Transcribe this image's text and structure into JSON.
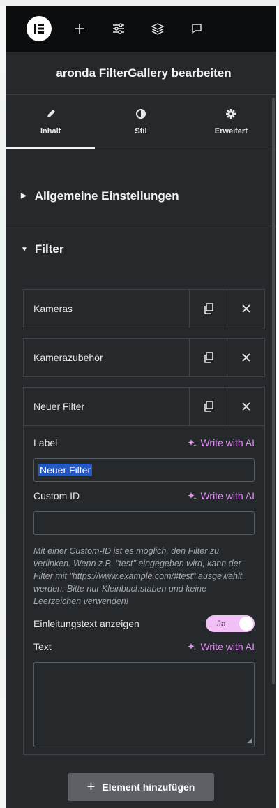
{
  "topbar": {
    "icons": [
      "elementor-logo-icon",
      "plus-icon",
      "sliders-icon",
      "layers-icon",
      "chat-icon"
    ]
  },
  "header": {
    "title": "aronda FilterGallery bearbeiten"
  },
  "tabs": [
    {
      "label": "Inhalt",
      "icon": "pencil-icon",
      "active": true
    },
    {
      "label": "Stil",
      "icon": "contrast-icon",
      "active": false
    },
    {
      "label": "Erweitert",
      "icon": "gear-icon",
      "active": false
    }
  ],
  "sections": {
    "general": {
      "label": "Allgemeine Einstellungen"
    },
    "filter": {
      "label": "Filter"
    }
  },
  "repeater": {
    "items": [
      {
        "label": "Kameras"
      },
      {
        "label": "Kamerazubehör"
      },
      {
        "label": "Neuer Filter"
      }
    ]
  },
  "editor": {
    "label_field": {
      "label": "Label",
      "value": "Neuer Filter"
    },
    "custom_id_field": {
      "label": "Custom ID",
      "value": ""
    },
    "ai_link": "Write with AI",
    "help_text": "Mit einer Custom-ID ist es möglich, den Filter zu verlinken. Wenn z.B. \"test\" eingegeben wird, kann der Filter mit \"https://www.example.com/#test\" ausgewählt werden. Bitte nur Kleinbuchstaben und keine Leerzeichen verwenden!",
    "intro_toggle": {
      "label": "Einleitungstext anzeigen",
      "value": "Ja",
      "on": true
    },
    "text_field": {
      "label": "Text",
      "value": ""
    }
  },
  "footer": {
    "add_label": "Element hinzufügen"
  },
  "colors": {
    "accent": "#e590f7",
    "panel": "#26292c",
    "topbar": "#0c0d0e",
    "toggle_on": "#f3bff7"
  }
}
